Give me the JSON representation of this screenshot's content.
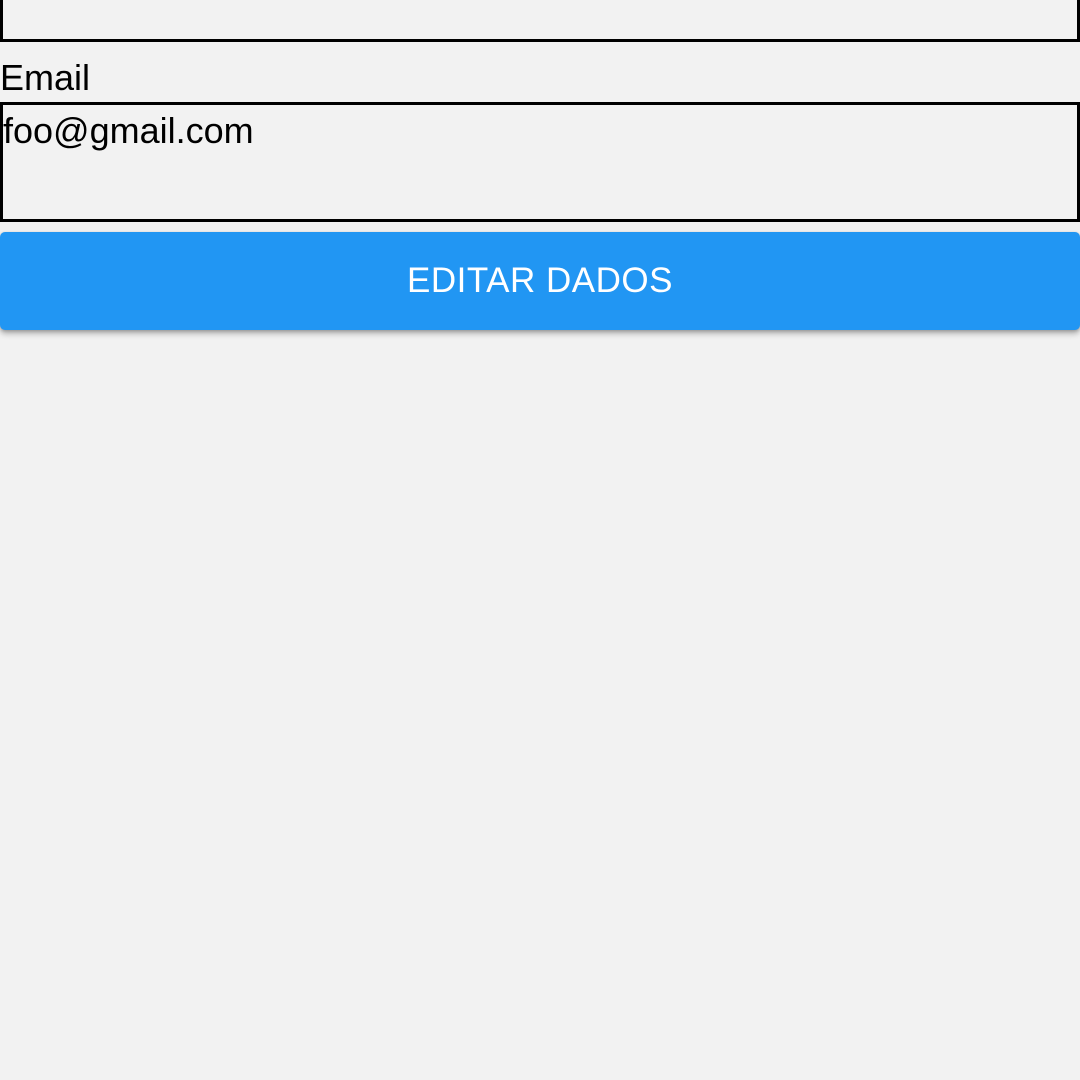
{
  "form": {
    "email_label": "Email",
    "email_value": "foo@gmail.com",
    "edit_button_label": "EDITAR DADOS"
  },
  "colors": {
    "background": "#f2f2f2",
    "button": "#2196f3",
    "button_text": "#ffffff",
    "field_border": "#000000"
  }
}
